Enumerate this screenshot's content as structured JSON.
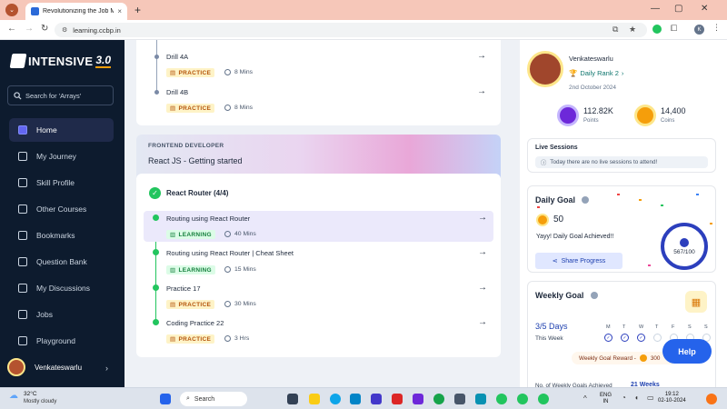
{
  "browser": {
    "tab_title": "Revolutionizing the Job Market",
    "tab_close": "×",
    "new_tab": "+",
    "url": "learning.ccbp.in",
    "win_min": "—",
    "win_max": "▢",
    "win_close": "✕",
    "profile_initial": "K"
  },
  "sidebar": {
    "logo_text": "INTENSIVE",
    "logo_version": "3.0",
    "search_placeholder": "Search for 'Arrays'",
    "items": [
      {
        "label": "Home"
      },
      {
        "label": "My Journey"
      },
      {
        "label": "Skill Profile"
      },
      {
        "label": "Other Courses"
      },
      {
        "label": "Bookmarks"
      },
      {
        "label": "Question Bank"
      },
      {
        "label": "My Discussions"
      },
      {
        "label": "Jobs"
      },
      {
        "label": "Playground"
      }
    ],
    "user_name": "Venkateswarlu"
  },
  "main": {
    "top_lessons": [
      {
        "title": "Drill 4A",
        "badge": "PRACTICE",
        "duration": "8 Mins"
      },
      {
        "title": "Drill 4B",
        "badge": "PRACTICE",
        "duration": "8 Mins"
      }
    ],
    "banner": {
      "kicker": "FRONTEND DEVELOPER",
      "title": "React JS - Getting started"
    },
    "module_title": "React Router (4/4)",
    "lessons": [
      {
        "title": "Routing using React Router",
        "badge": "LEARNING",
        "duration": "40 Mins"
      },
      {
        "title": "Routing using React Router | Cheat Sheet",
        "badge": "LEARNING",
        "duration": "15 Mins"
      },
      {
        "title": "Practice 17",
        "badge": "PRACTICE",
        "duration": "30 Mins"
      },
      {
        "title": "Coding Practice 22",
        "badge": "PRACTICE",
        "duration": "3 Hrs"
      }
    ]
  },
  "profile": {
    "name": "Venkateswarlu",
    "rank": "Daily Rank 2",
    "date": "2nd October 2024",
    "points_value": "112.82K",
    "points_label": "Points",
    "coins_value": "14,400",
    "coins_label": "Coins"
  },
  "live_sessions": {
    "title": "Live Sessions",
    "message": "Today there are no live sessions to attend!"
  },
  "daily_goal": {
    "title": "Daily Goal",
    "coins": "50",
    "message": "Yayy! Daily Goal Achieved!!",
    "share_label": "Share Progress",
    "progress_text": "567/100",
    "progress_fraction": 1.0
  },
  "weekly_goal": {
    "title": "Weekly Goal",
    "days": "3/5 Days",
    "period": "This Week",
    "day_labels": [
      "M",
      "T",
      "W",
      "T",
      "F",
      "S",
      "S"
    ],
    "reward_label": "Weekly Goal Reward -",
    "reward_value": "300",
    "footer_label": "No. of Weekly Goals Achieved",
    "footer_value": "21 Weeks"
  },
  "help": {
    "label": "Help"
  },
  "taskbar": {
    "temp": "32°C",
    "weather": "Mostly cloudy",
    "search": "Search",
    "lang1": "ENG",
    "lang2": "IN",
    "time": "19:12",
    "date": "02-10-2024"
  },
  "colors": {
    "sidebar_bg": "#0d1b2e",
    "accent_blue": "#2563eb",
    "practice_badge": "#b45309",
    "learning_badge": "#15803d",
    "complete_green": "#22c55e"
  }
}
